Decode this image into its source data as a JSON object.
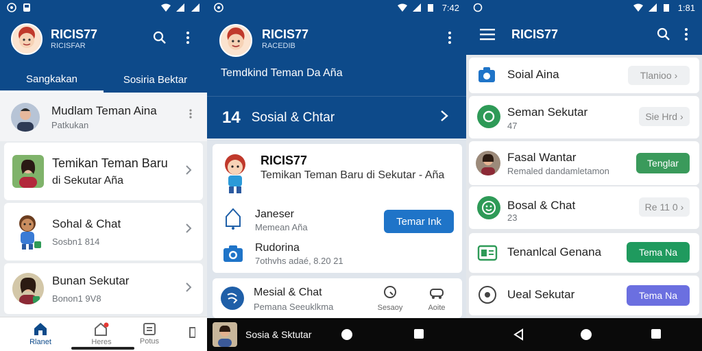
{
  "screen1": {
    "statusbar": {
      "left_icons": [
        "whatsapp-icon",
        "save-icon"
      ]
    },
    "header": {
      "title": "RICIS77",
      "subtitle": "RICISFAR"
    },
    "tabs": [
      {
        "label": "Sangkakan"
      },
      {
        "label": "Sosiria Bektar"
      }
    ],
    "list": [
      {
        "title": "Mudlam Teman Aina",
        "subtitle": "Patkukan"
      },
      {
        "title": "Temikan Teman Baru",
        "subtitle": "di Sekutar Aña"
      },
      {
        "title": "Sohal & Chat",
        "subtitle": "Sosbn1 814"
      },
      {
        "title": "Bunan Sekutar",
        "subtitle": "Bonon1 9V8"
      }
    ],
    "bottom_nav": [
      {
        "label": "Rlanet"
      },
      {
        "label": "Heres"
      },
      {
        "label": "Potus"
      }
    ]
  },
  "screen2": {
    "statusbar": {
      "time": "7:42"
    },
    "header": {
      "title": "RICIS77",
      "subtitle": "RACEDIB",
      "tagline": "Temdkind Teman Da Aña"
    },
    "banner": {
      "label": "Sosial & Chtar",
      "icon_text": "14"
    },
    "card": {
      "title": "RICIS77",
      "description": "Temikan Teman Baru di Sekutar - Aña",
      "row1_title": "Janeser",
      "row1_sub": "Memean Aña",
      "button": "Temar Ink",
      "row2_title": "Rudorina",
      "row2_sub": "7othvhs adaé, 8.20 21"
    },
    "bottom_card": {
      "title": "Mesial & Chat",
      "sub": "Pemana Seeuklkma",
      "action1": "Sesaoy",
      "action2": "Aoite"
    },
    "dark_bar": {
      "label": "Sosia & Sktutar"
    }
  },
  "screen3": {
    "statusbar": {
      "time": "1:81"
    },
    "header": {
      "title": "RICIS77"
    },
    "items": [
      {
        "title": "Soial Aina",
        "sub": "",
        "action": "Tlanioo",
        "action_style": "chip"
      },
      {
        "title": "Seman Sekutar",
        "sub": "47",
        "action": "Sie Hrd",
        "action_style": "chip"
      },
      {
        "title": "Fasal Wantar",
        "sub": "Remaled dandamletamon",
        "action": "Tenglar",
        "action_style": "green"
      },
      {
        "title": "Bosal & Chat",
        "sub": "23",
        "action": "Re 11 0",
        "action_style": "chip"
      },
      {
        "title": "Tenanlcal Genana",
        "sub": "",
        "action": "Tema Na",
        "action_style": "green2"
      },
      {
        "title": "Ueal Sekutar",
        "sub": "",
        "action": "Tema Na",
        "action_style": "purple"
      }
    ]
  },
  "colors": {
    "primary": "#0d4a8a",
    "accent_blue": "#1f74c8",
    "green": "#2e9a57",
    "purple": "#6b6fe0"
  }
}
